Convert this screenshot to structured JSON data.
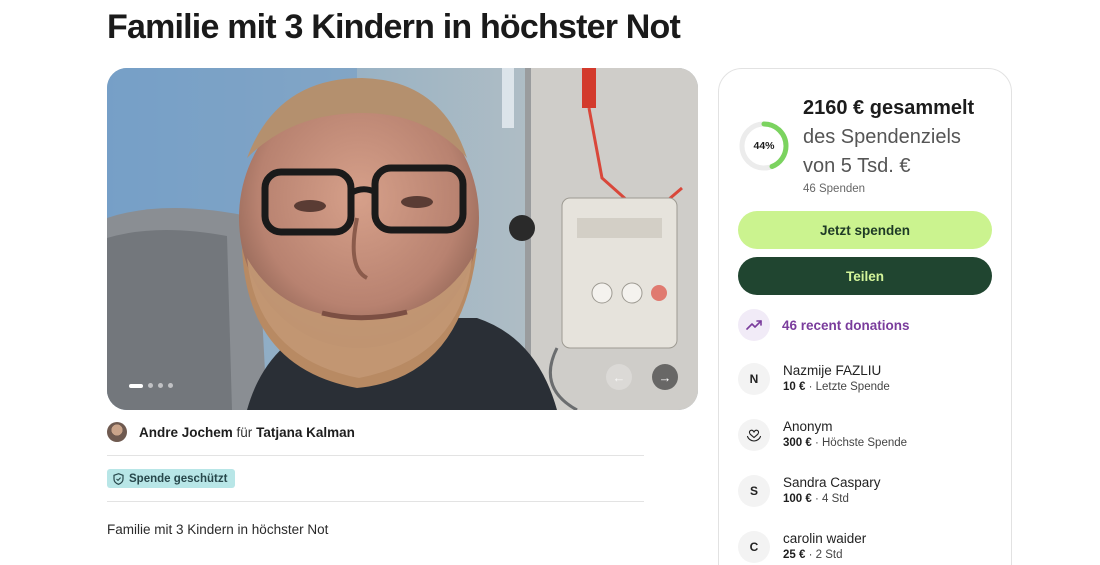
{
  "page": {
    "title": "Familie mit 3 Kindern in höchster Not",
    "description": "Familie mit 3 Kindern in höchster Not"
  },
  "gallery": {
    "slide_count": 4,
    "active_slide": 1,
    "prev_icon": "arrow-left-icon",
    "next_icon": "arrow-right-icon"
  },
  "organizer": {
    "name": "Andre Jochem",
    "connector": "für",
    "beneficiary": "Tatjana Kalman"
  },
  "badge": {
    "icon": "shield-icon",
    "label": "Spende geschützt"
  },
  "campaign": {
    "progress_percent": 44,
    "progress_label": "44%",
    "raised": "2160 € gesammelt",
    "goal_line1": "des Spendenziels",
    "goal_line2": "von 5 Tsd. €",
    "donation_count": "46 Spenden",
    "donate_label": "Jetzt spenden",
    "share_label": "Teilen",
    "recent_label": "46 recent donations",
    "recent_icon": "trending-up-icon"
  },
  "donors": [
    {
      "initial": "N",
      "icon": "",
      "name": "Nazmije FAZLIU",
      "amount": "10 €",
      "note": " · Letzte Spende"
    },
    {
      "initial": "",
      "icon": "heart-hand-icon",
      "name": "Anonym",
      "amount": "300 €",
      "note": " · Höchste Spende"
    },
    {
      "initial": "S",
      "icon": "",
      "name": "Sandra Caspary",
      "amount": "100 €",
      "note": " · 4 Std"
    },
    {
      "initial": "C",
      "icon": "",
      "name": "carolin waider",
      "amount": "25 €",
      "note": " · 2 Std"
    }
  ],
  "colors": {
    "accent_green": "#cbf38f",
    "dark_green": "#204530",
    "progress_green": "#7bd35f",
    "badge_teal": "#b8e6e7",
    "recent_purple": "#7a3c9c"
  }
}
